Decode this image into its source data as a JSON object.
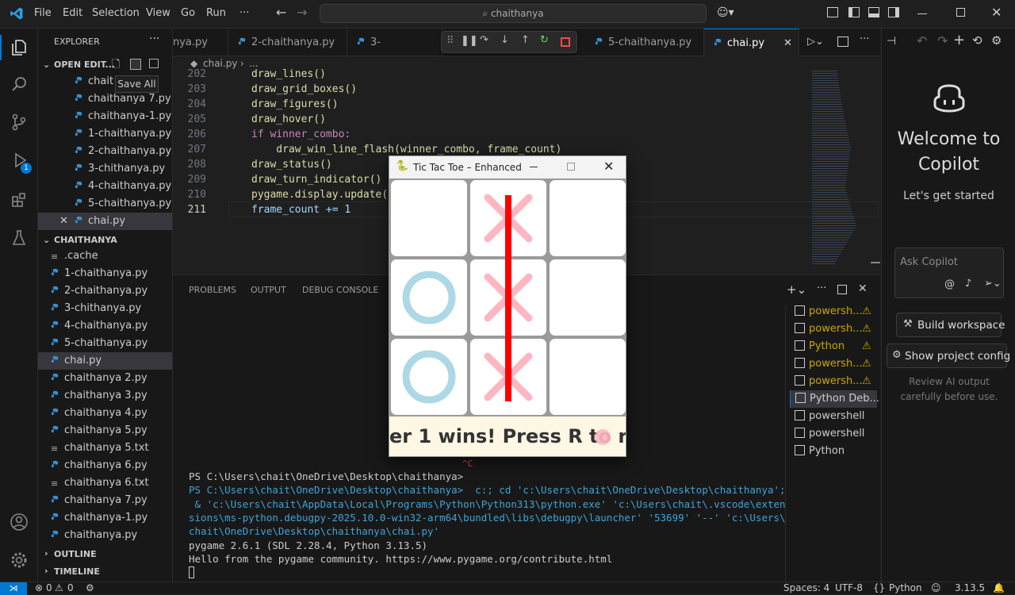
{
  "titlebar": {
    "menu": [
      "File",
      "Edit",
      "Selection",
      "View",
      "Go",
      "Run",
      "···"
    ],
    "search": "chaithanya"
  },
  "explorer": {
    "title": "EXPLORER",
    "open_editors_title": "OPEN EDIT...",
    "tooltip": "Save All",
    "open_editors": [
      "chait",
      "chaithanya 7.py",
      "chaithanya-1.py",
      "1-chaithanya.py",
      "2-chaithanya.py",
      "3-chithanya.py",
      "4-chaithanya.py",
      "5-chaithanya.py",
      "chai.py"
    ],
    "folder_title": "CHAITHANYA",
    "files": [
      ".cache",
      "1-chaithanya.py",
      "2-chaithanya.py",
      "3-chithanya.py",
      "4-chaithanya.py",
      "5-chaithanya.py",
      "chai.py",
      "chaithanya 2.py",
      "chaithanya 3.py",
      "chaithanya 4.py",
      "chaithanya 5.py",
      "chaithanya 5.txt",
      "chaithanya 6.py",
      "chaithanya 6.txt",
      "chaithanya 7.py",
      "chaithanya-1.py",
      "chaithanya.py"
    ],
    "outline": "OUTLINE",
    "timeline": "TIMELINE",
    "debug_badge": "1"
  },
  "tabs": [
    "nya.py",
    "2-chaithanya.py",
    "3-chithanya.py",
    "5-chaithanya.py",
    "chai.py"
  ],
  "breadcrumb": {
    "file": "chai.py",
    "more": "..."
  },
  "code": [
    {
      "n": "202",
      "t": "draw_lines()"
    },
    {
      "n": "203",
      "t": "draw_grid_boxes()"
    },
    {
      "n": "204",
      "t": "draw_figures()"
    },
    {
      "n": "205",
      "t": "draw_hover()"
    },
    {
      "n": "206",
      "t": "if winner_combo:"
    },
    {
      "n": "207",
      "t": "    draw_win_line_flash(winner_combo, frame_count)"
    },
    {
      "n": "208",
      "t": "draw_status()"
    },
    {
      "n": "209",
      "t": "draw_turn_indicator()"
    },
    {
      "n": "210",
      "t": "pygame.display.update()"
    },
    {
      "n": "211",
      "t": "frame_count += 1"
    }
  ],
  "panel": {
    "tabs": [
      "PROBLEMS",
      "OUTPUT",
      "DEBUG CONSOLE"
    ],
    "terminals": [
      {
        "label": "powersh...",
        "warn": true
      },
      {
        "label": "powersh...",
        "warn": true
      },
      {
        "label": "Python",
        "warn": true
      },
      {
        "label": "powersh...",
        "warn": true
      },
      {
        "label": "powersh...",
        "warn": true
      },
      {
        "label": "Python Deb...",
        "warn": false
      },
      {
        "label": "powershell",
        "warn": false
      },
      {
        "label": "powershell",
        "warn": false
      },
      {
        "label": "Python",
        "warn": false
      }
    ],
    "ctrlc": "^C",
    "lines": [
      "PS C:\\Users\\chait\\OneDrive\\Desktop\\chaithanya>",
      "PS C:\\Users\\chait\\OneDrive\\Desktop\\chaithanya>  c:; cd 'c:\\Users\\chait\\OneDrive\\Desktop\\chaithanya';",
      " & 'c:\\Users\\chait\\AppData\\Local\\Programs\\Python\\Python313\\python.exe' 'c:\\Users\\chait\\.vscode\\exten",
      "sions\\ms-python.debugpy-2025.10.0-win32-arm64\\bundled\\libs\\debugpy\\launcher' '53699' '--' 'c:\\Users\\",
      "chait\\OneDrive\\Desktop\\chaithanya\\chai.py'",
      "pygame 2.6.1 (SDL 2.28.4, Python 3.13.5)",
      "Hello from the pygame community. https://www.pygame.org/contribute.html"
    ]
  },
  "pygame": {
    "title": "Tic Tac Toe – Enhanced",
    "board": [
      "",
      "X",
      "",
      "O",
      "X",
      "",
      "O",
      "X",
      ""
    ],
    "status": "er 1 wins! Press R to res"
  },
  "copilot": {
    "welcome": "Welcome to Copilot",
    "subtitle": "Let's get started",
    "ask_placeholder": "Ask Copilot",
    "build": "Build workspace",
    "show_config": "Show project config",
    "review": "Review AI output carefully before use."
  },
  "status": {
    "errors": "0",
    "warnings": "0",
    "spaces": "Spaces: 4",
    "encoding": "UTF-8",
    "lang": "Python",
    "version": "3.13.5",
    "braces": "{}"
  },
  "colors": {
    "accent": "#0078d4",
    "o_color": "#add8e6",
    "x_color": "#ffb6c1",
    "win_line": "#ff0000",
    "warn": "#cca700"
  }
}
